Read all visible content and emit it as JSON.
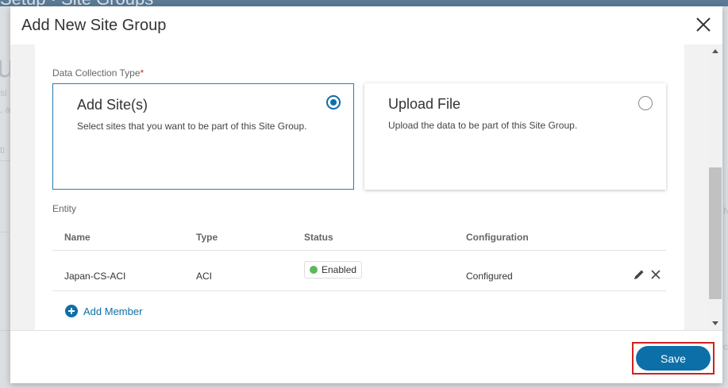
{
  "background": {
    "title": "Setup · Site Groups",
    "letter": "u",
    "fragments": [
      "si",
      ", a",
      "ti",
      "N",
      "c"
    ]
  },
  "modal": {
    "title": "Add New Site Group",
    "close_icon": "close-icon"
  },
  "data_collection": {
    "label": "Data Collection Type",
    "required_mark": "*",
    "options": [
      {
        "title": "Add Site(s)",
        "description": "Select sites that you want to be part of this Site Group.",
        "selected": true
      },
      {
        "title": "Upload File",
        "description": "Upload the data to be part of this Site Group.",
        "selected": false
      }
    ]
  },
  "entity": {
    "label": "Entity",
    "columns": [
      "Name",
      "Type",
      "Status",
      "Configuration"
    ],
    "rows": [
      {
        "name": "Japan-CS-ACI",
        "type": "ACI",
        "status": "Enabled",
        "configuration": "Configured"
      }
    ],
    "row_actions": [
      "pencil-icon",
      "delete-x-icon"
    ],
    "add_member_label": "Add Member"
  },
  "footer": {
    "save_label": "Save"
  },
  "colors": {
    "accent": "#0d6fa8",
    "status_enabled": "#5cb85c",
    "highlight": "#d21f1f"
  }
}
